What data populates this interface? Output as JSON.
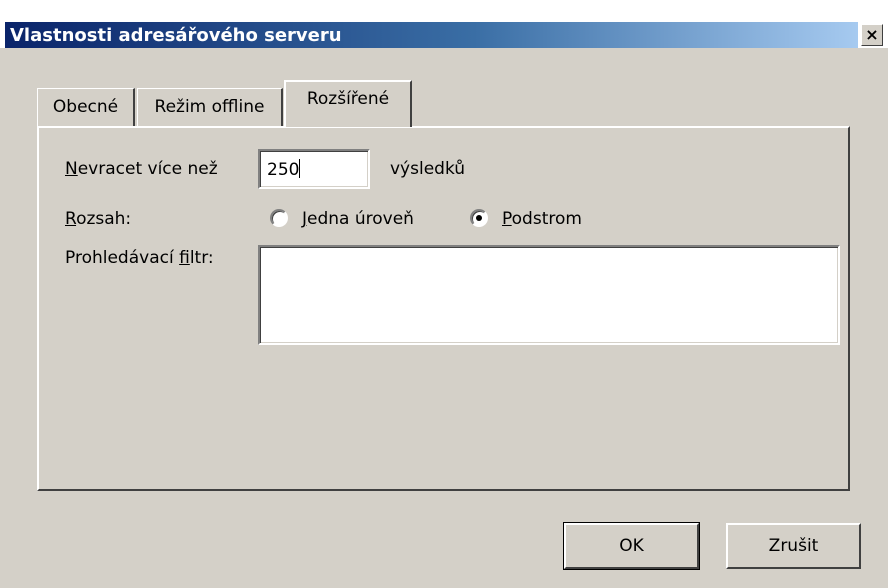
{
  "window": {
    "title": "Vlastnosti adresářového serveru",
    "close_label": "×"
  },
  "tabs": [
    {
      "label": "Obecné",
      "active": false
    },
    {
      "label": "Režim offline",
      "active": false
    },
    {
      "label": "Rozšířené",
      "active": true
    }
  ],
  "advanced": {
    "max_results": {
      "label_hotkey": "N",
      "label_rest": "evracet více než",
      "value": "250",
      "suffix": "výsledků"
    },
    "scope": {
      "label_hotkey": "R",
      "label_rest": "ozsah:",
      "options": [
        {
          "hotkey": "J",
          "rest": "edna úroveň",
          "selected": false
        },
        {
          "hotkey": "P",
          "rest": "odstrom",
          "selected": true
        }
      ]
    },
    "search_filter": {
      "label_start": "Prohledávací ",
      "label_hotkey": "f",
      "label_rest": "iltr:",
      "value": ""
    }
  },
  "buttons": {
    "ok": "OK",
    "cancel": "Zrušit"
  }
}
